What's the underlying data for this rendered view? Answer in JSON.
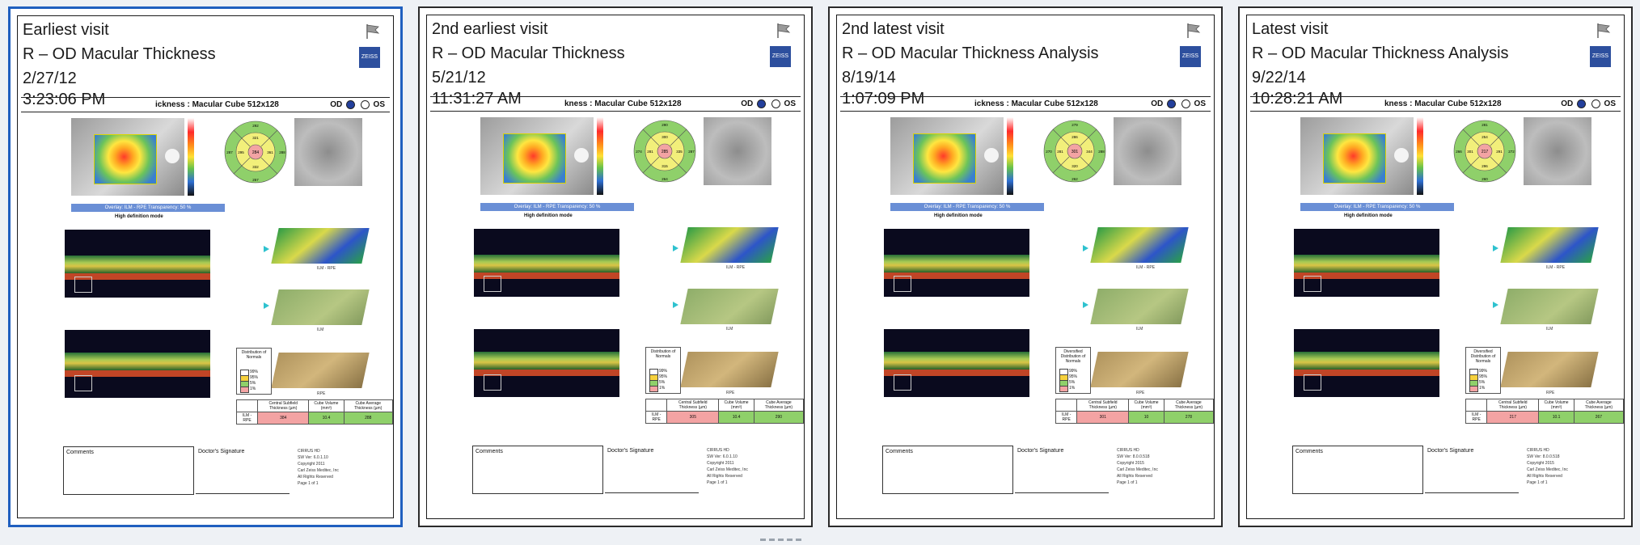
{
  "colors": {
    "selected_border": "#1f5fbf",
    "zeiss_blue": "#2d4f9e"
  },
  "cards": [
    {
      "visit_label": "Earliest visit",
      "report_title": "R – OD Macular Thickness",
      "date": "2/27/12",
      "time": "3:23:06 PM",
      "scan_title": "ickness : Macular Cube 512x128",
      "od": "OD",
      "os": "OS",
      "zeiss": "ZEISS",
      "overlay_text": "Overlay: ILM - RPE  Transparency: 50 %",
      "hd_label": "High definition mode",
      "etdrs": {
        "center": "284",
        "ring": [
          "321",
          "361",
          "332",
          "295"
        ],
        "outer": [
          "292",
          "288",
          "257",
          "287"
        ]
      },
      "map_captions": [
        "ILM - RPE",
        "ILM",
        "RPE"
      ],
      "dist_title": "Distribution of Normals",
      "dist_levels": [
        "99%",
        "95%",
        "5%",
        "1%"
      ],
      "table_headers": [
        "Central Subfield Thickness (µm)",
        "Cube Volume (mm³)",
        "Cube Average Thickness (µm)"
      ],
      "table_row_label": "ILM - RPE",
      "table_values": [
        "384",
        "10.4",
        "288"
      ],
      "comments": "Comments",
      "signature": "Doctor's Signature",
      "footer": [
        "CIRRUS HD",
        "SW Ver: 6.0.1.10",
        "Copyright 2011",
        "Carl Zeiss Meditec, Inc",
        "All Rights Reserved",
        "Page 1 of 1"
      ],
      "selected": true
    },
    {
      "visit_label": "2nd earliest visit",
      "report_title": "R – OD Macular Thickness",
      "date": "5/21/12",
      "time": "11:31:27 AM",
      "scan_title": "kness : Macular Cube 512x128",
      "od": "OD",
      "os": "OS",
      "zeiss": "ZEISS",
      "overlay_text": "Overlay: ILM - RPE  Transparency: 50 %",
      "hd_label": "High definition mode",
      "etdrs": {
        "center": "285",
        "ring": [
          "300",
          "335",
          "315",
          "281"
        ],
        "outer": [
          "290",
          "287",
          "264",
          "274"
        ]
      },
      "map_captions": [
        "ILM - RPE",
        "ILM",
        "RPE"
      ],
      "dist_title": "Distribution of Normals",
      "dist_levels": [
        "99%",
        "95%",
        "5%",
        "1%"
      ],
      "table_headers": [
        "Central Subfield Thickness (µm)",
        "Cube Volume (mm³)",
        "Cube Average Thickness (µm)"
      ],
      "table_row_label": "ILM - RPE",
      "table_values": [
        "305",
        "10.4",
        "290"
      ],
      "comments": "Comments",
      "signature": "Doctor's Signature",
      "footer": [
        "CIRRUS HD",
        "SW Ver: 6.0.1.10",
        "Copyright 2011",
        "Carl Zeiss Meditec, Inc",
        "All Rights Reserved",
        "Page 1 of 1"
      ],
      "selected": false
    },
    {
      "visit_label": "2nd latest visit",
      "report_title": "R – OD Macular Thickness Analysis",
      "date": "8/19/14",
      "time": "1:07:09 PM",
      "scan_title": "ickness : Macular Cube 512x128",
      "od": "OD",
      "os": "OS",
      "zeiss": "ZEISS",
      "overlay_text": "Overlay: ILM - RPE  Transparency: 50 %",
      "hd_label": "High definition mode",
      "etdrs": {
        "center": "301",
        "ring": [
          "286",
          "344",
          "320",
          "281"
        ],
        "outer": [
          "279",
          "288",
          "262",
          "270"
        ]
      },
      "map_captions": [
        "ILM - RPE",
        "ILM",
        "RPE"
      ],
      "dist_title": "Diversified Distribution of Normals",
      "dist_levels": [
        "99%",
        "95%",
        "5%",
        "1%"
      ],
      "table_headers": [
        "Central Subfield Thickness (µm)",
        "Cube Volume (mm³)",
        "Cube Average Thickness (µm)"
      ],
      "table_row_label": "ILM - RPE",
      "table_values": [
        "301",
        "10",
        "278"
      ],
      "comments": "Comments",
      "signature": "Doctor's Signature",
      "footer": [
        "CIRRUS HD",
        "SW Ver: 8.0.0.518",
        "Copyright 2015",
        "Carl Zeiss Meditec, Inc",
        "All Rights Reserved",
        "Page 1 of 1"
      ],
      "selected": false
    },
    {
      "visit_label": "Latest visit",
      "report_title": "R – OD Macular Thickness Analysis",
      "date": "9/22/14",
      "time": "10:28:21 AM",
      "scan_title": "kness : Macular Cube 512x128",
      "od": "OD",
      "os": "OS",
      "zeiss": "ZEISS",
      "overlay_text": "Overlay: ILM - RPE  Transparency: 50 %",
      "hd_label": "High definition mode",
      "etdrs": {
        "center": "217",
        "ring": [
          "254",
          "291",
          "296",
          "301"
        ],
        "outer": [
          "281",
          "272",
          "260",
          "266"
        ]
      },
      "map_captions": [
        "ILM - RPE",
        "ILM",
        "RPE"
      ],
      "dist_title": "Diversified Distribution of Normals",
      "dist_levels": [
        "99%",
        "95%",
        "5%",
        "1%"
      ],
      "table_headers": [
        "Central Subfield Thickness (µm)",
        "Cube Volume (mm³)",
        "Cube Average Thickness (µm)"
      ],
      "table_row_label": "ILM - RPE",
      "table_values": [
        "217",
        "10.1",
        "267"
      ],
      "comments": "Comments",
      "signature": "Doctor's Signature",
      "footer": [
        "CIRRUS HD",
        "SW Ver: 8.0.0.518",
        "Copyright 2015",
        "Carl Zeiss Meditec, Inc",
        "All Rights Reserved",
        "Page 1 of 1"
      ],
      "selected": false
    }
  ]
}
